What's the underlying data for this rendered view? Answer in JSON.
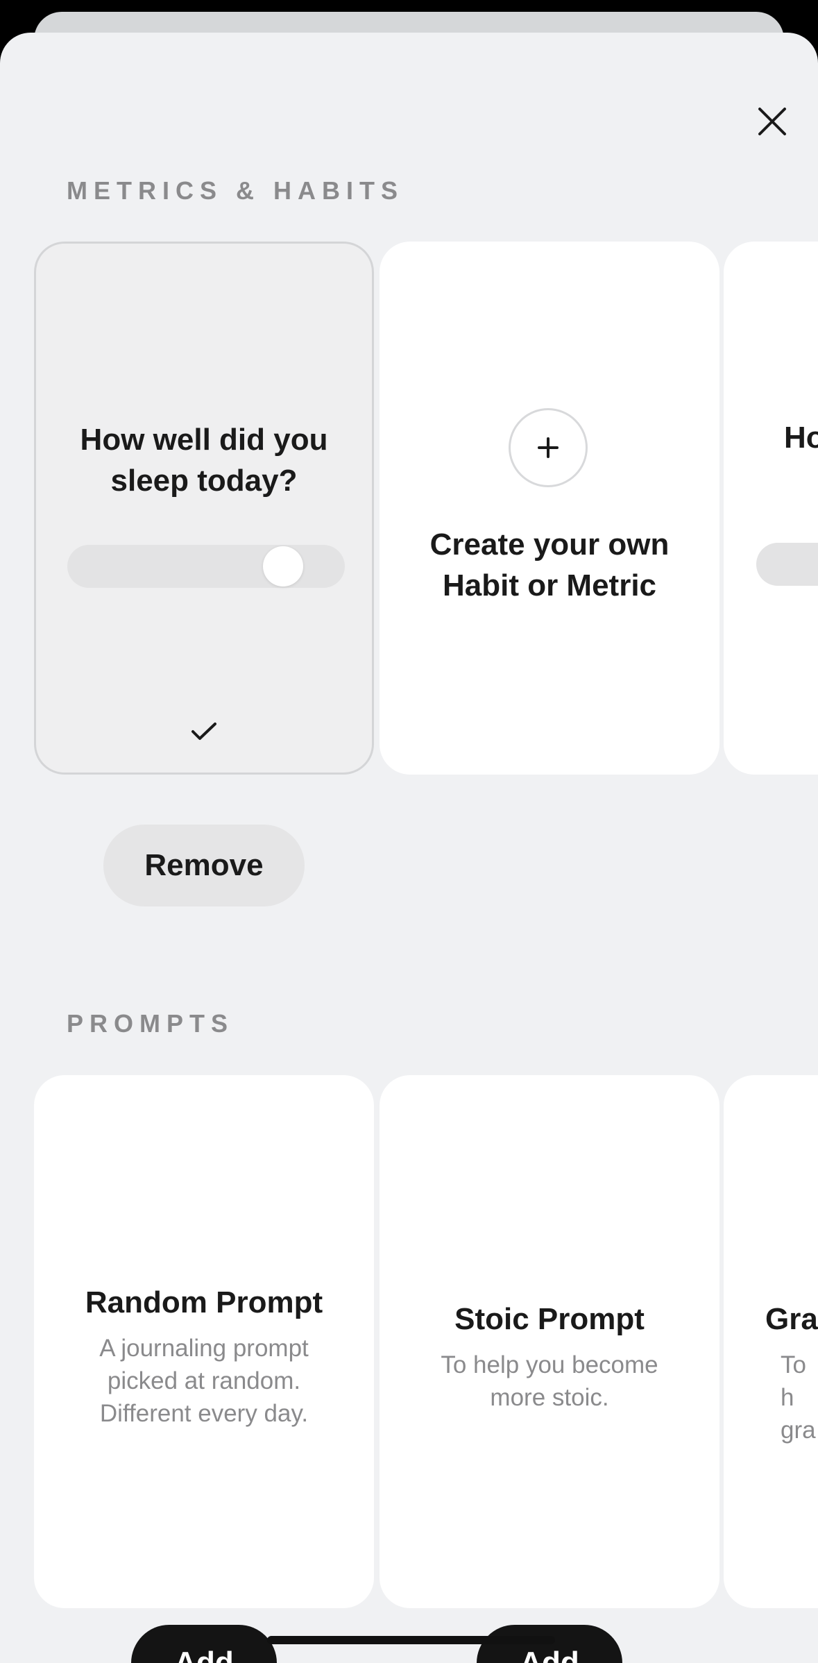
{
  "sections": {
    "metrics_title": "METRICS & HABITS",
    "prompts_title": "PROMPTS"
  },
  "metrics": {
    "sleep_card": {
      "title": "How well did you sleep today?",
      "slider_value_fraction": 0.77,
      "selected": true
    },
    "create_card": {
      "title": "Create your own Habit or Metric"
    },
    "partial_card": {
      "title_fragment": "Ho"
    },
    "remove_label": "Remove"
  },
  "prompts": [
    {
      "title": "Random Prompt",
      "description": "A journaling prompt picked at random. Different every day."
    },
    {
      "title": "Stoic Prompt",
      "description": "To help you become more stoic."
    },
    {
      "title": "Gra",
      "description": "To h gra"
    }
  ],
  "add_label": "Add",
  "icons": {
    "close": "close-icon",
    "check": "checkmark-icon",
    "plus": "plus-icon"
  },
  "colors": {
    "sheet_bg": "#f0f1f3",
    "card_bg": "#ffffff",
    "section_title": "#8a8a8c",
    "add_button": "#141414"
  }
}
